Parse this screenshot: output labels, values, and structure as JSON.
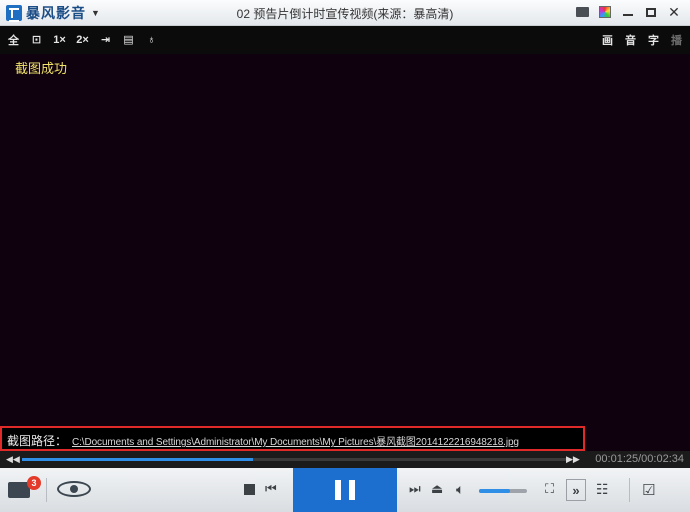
{
  "app": {
    "name": "暴风影音",
    "title": "02 预告片倒计时宣传视频(来源：暴高清)"
  },
  "window_controls": [
    "chat-icon",
    "skin-icon",
    "minimize-icon",
    "maximize-icon",
    "close-icon"
  ],
  "toolbar": {
    "left": [
      {
        "name": "fullscreen",
        "label": "全"
      },
      {
        "name": "mini-mode",
        "label": "⊡"
      },
      {
        "name": "speed-1x",
        "label": "1×"
      },
      {
        "name": "speed-2x",
        "label": "2×"
      },
      {
        "name": "pin",
        "label": "⇥"
      },
      {
        "name": "screenshot",
        "label": "▤"
      },
      {
        "name": "light",
        "label": "♁"
      }
    ],
    "right": [
      {
        "name": "picture",
        "label": "画"
      },
      {
        "name": "audio",
        "label": "音"
      },
      {
        "name": "subtitle",
        "label": "字"
      },
      {
        "name": "play-mode",
        "label": "播"
      }
    ]
  },
  "video": {
    "toast": "截图成功"
  },
  "screenshot_path": {
    "label": "截图路径：",
    "path": "C:\\Documents and Settings\\Administrator\\My Documents\\My Pictures\\暴风截图20141222169​48218.jpg"
  },
  "playback": {
    "progress": 0.42,
    "time": "00:01:25/00:02:34"
  },
  "controls": {
    "badge_count": "3",
    "volume": 0.65
  },
  "colors": {
    "accent": "#1c6fcf",
    "highlight_border": "#e02a2a",
    "toast": "#f2e36a"
  }
}
